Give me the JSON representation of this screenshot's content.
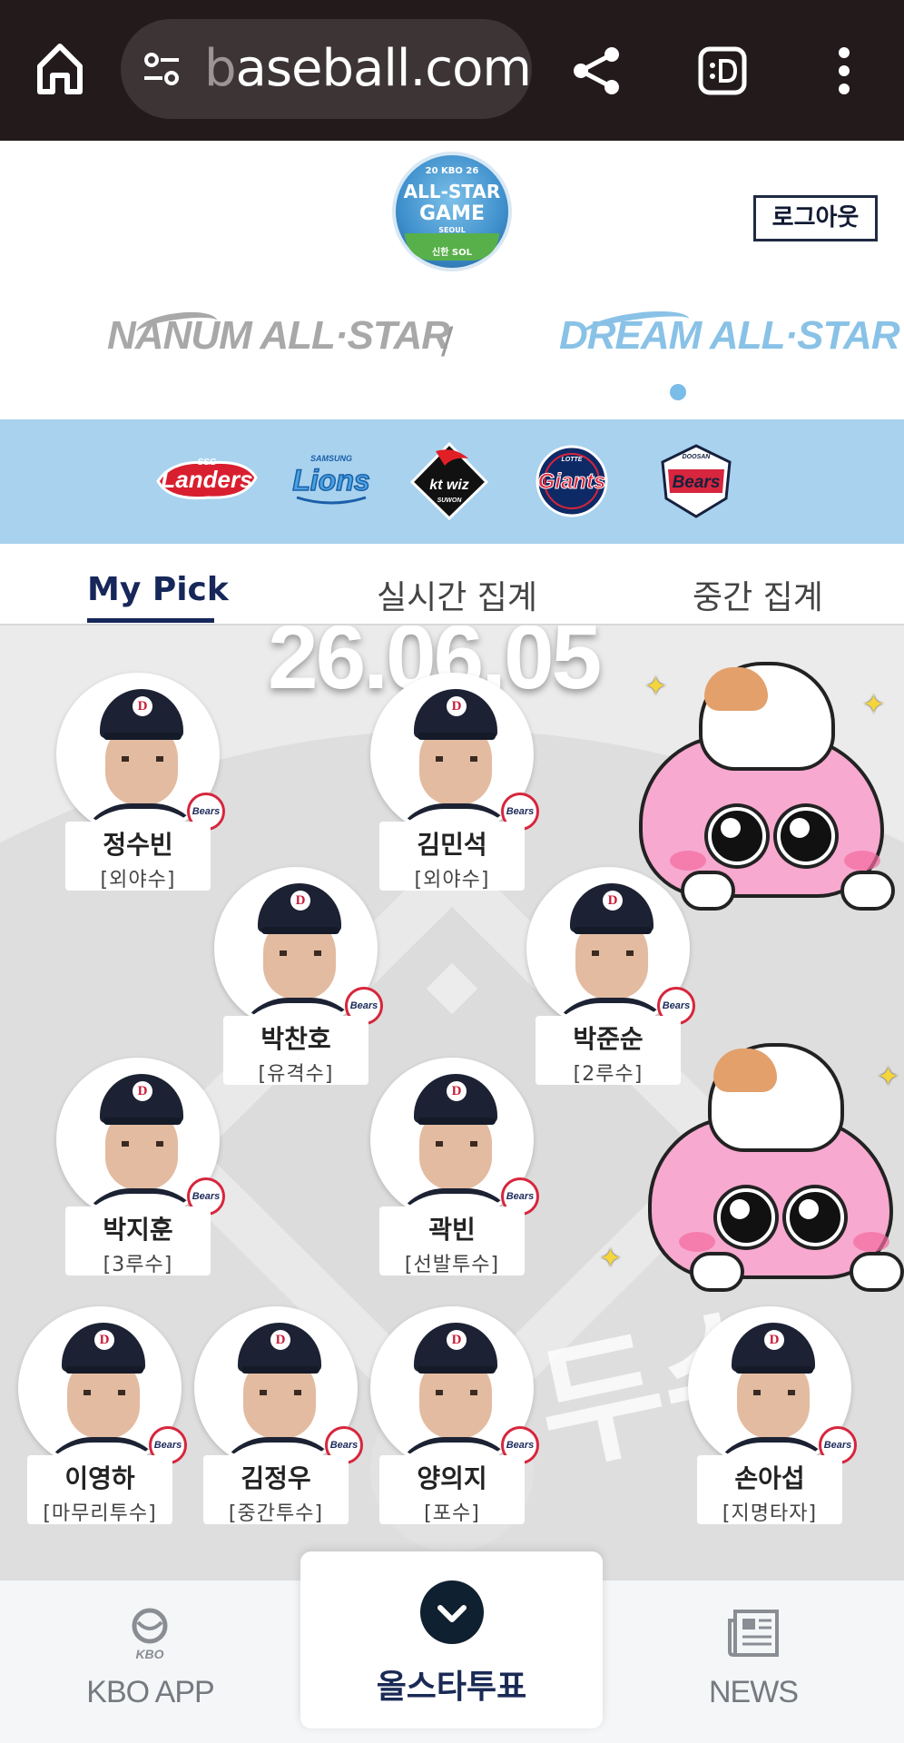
{
  "browser": {
    "url_faded": "b",
    "url_main": "aseball.com"
  },
  "header": {
    "emblem_top": "20 KBO 26",
    "emblem_line1": "ALL-STAR",
    "emblem_line2": "GAME",
    "emblem_city": "SEOUL",
    "emblem_sponsor": "신한 SOL",
    "logout_label": "로그아웃",
    "team_nanum": "NANUM ALL·STAR",
    "team_separator": "/",
    "team_dream": "DREAM ALL·STAR"
  },
  "teams": [
    "Landers",
    "Lions",
    "kt wiz",
    "Giants",
    "Bears"
  ],
  "team_small": {
    "ssg": "SSG",
    "samsung": "SAMSUNG",
    "kt_sub": "SUWON",
    "lotte": "LOTTE",
    "doosan": "DOOSAN"
  },
  "tabs": [
    "My Pick",
    "실시간 집계",
    "중간 집계"
  ],
  "field": {
    "date": "26.06.05",
    "cap_letter": "D",
    "badge_text": "Bears",
    "watermark": "두슈"
  },
  "players": [
    {
      "name": "정수빈",
      "pos": "[외야수]"
    },
    {
      "name": "김민석",
      "pos": "[외야수]"
    },
    {
      "name": "박찬호",
      "pos": "[유격수]"
    },
    {
      "name": "박준순",
      "pos": "[2루수]"
    },
    {
      "name": "박지훈",
      "pos": "[3루수]"
    },
    {
      "name": "곽빈",
      "pos": "[선발투수]"
    },
    {
      "name": "이영하",
      "pos": "[마무리투수]"
    },
    {
      "name": "김정우",
      "pos": "[중간투수]"
    },
    {
      "name": "양의지",
      "pos": "[포수]"
    },
    {
      "name": "손아섭",
      "pos": "[지명타자]"
    }
  ],
  "bottom_nav": {
    "kbo_small": "KBO",
    "kbo_label": "KBO APP",
    "vote_label": "올스타투표",
    "news_label": "NEWS"
  },
  "colors": {
    "browser_bg": "#231a1c",
    "strip_bg": "#a8d2ee",
    "active_tab": "#16275a",
    "mascot_pink": "#f7a9cf"
  }
}
